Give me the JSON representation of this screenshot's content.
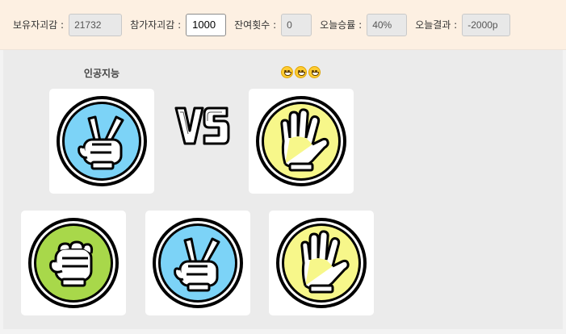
{
  "header": {
    "holding": {
      "label": "보유자괴감 :",
      "value": "21732"
    },
    "bet": {
      "label": "참가자괴감 :",
      "value": "1000"
    },
    "remaining": {
      "label": "잔여횟수 :",
      "value": "0"
    },
    "win_rate": {
      "label": "오늘승률 :",
      "value": "40%"
    },
    "result": {
      "label": "오늘결과 :",
      "value": "-2000p"
    }
  },
  "match": {
    "player_label": "인공지능",
    "opponent_emojis": [
      "grinning-face",
      "grinning-face",
      "grinning-face"
    ],
    "vs_text": "VS",
    "player_hand": "scissors",
    "opponent_hand": "paper"
  },
  "choices": [
    {
      "hand": "rock",
      "color": "#a8d84a"
    },
    {
      "hand": "scissors",
      "color": "#7cd3f7"
    },
    {
      "hand": "paper",
      "color": "#f7f78a"
    }
  ],
  "colors": {
    "rock": "#a8d84a",
    "scissors": "#7cd3f7",
    "paper": "#f7f78a"
  }
}
